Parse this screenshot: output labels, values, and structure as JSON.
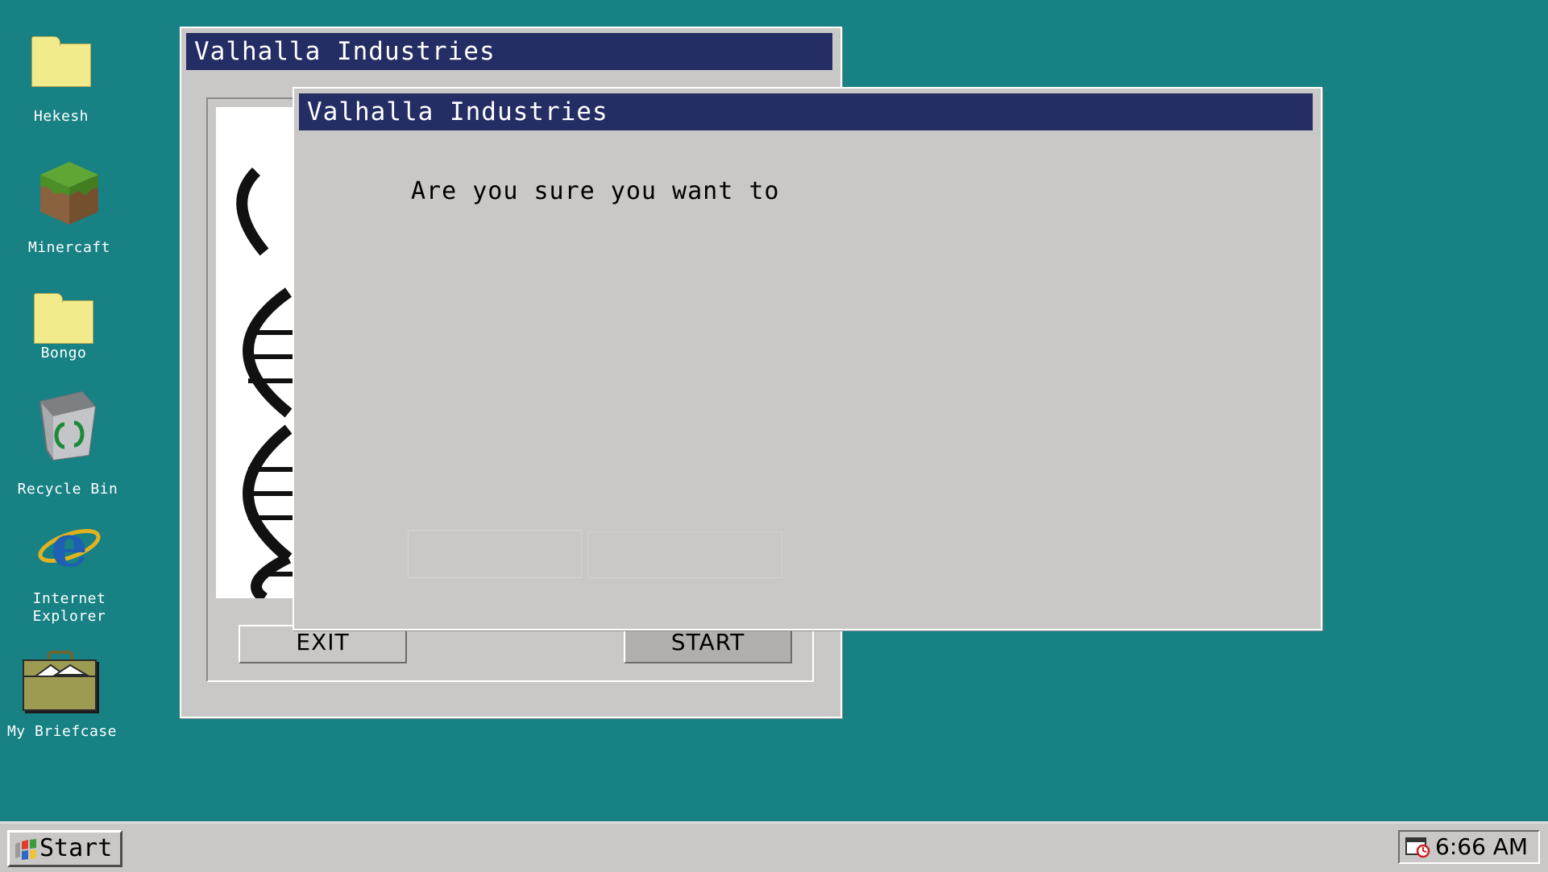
{
  "desktop": {
    "icons": [
      {
        "label": "Hekesh",
        "icon": "folder-icon"
      },
      {
        "label": "Minercaft",
        "icon": "grass-block-icon"
      },
      {
        "label": "Bongo",
        "icon": "folder-icon"
      },
      {
        "label": "Recycle Bin",
        "icon": "recycle-bin-icon"
      },
      {
        "label": "Internet Explorer",
        "icon": "internet-explorer-icon"
      },
      {
        "label": "My Briefcase",
        "icon": "briefcase-icon"
      }
    ]
  },
  "back_window": {
    "title": "Valhalla Industries",
    "exit_label": "EXIT",
    "start_label": "START",
    "image": "dna-helix-icon"
  },
  "dialog": {
    "title": "Valhalla Industries",
    "message": "Are you sure you want to"
  },
  "taskbar": {
    "start_label": "Start",
    "clock": "6:66 AM"
  },
  "colors": {
    "desktop": "#178184",
    "titlebar": "#242d64",
    "window": "#c9c8c7"
  }
}
